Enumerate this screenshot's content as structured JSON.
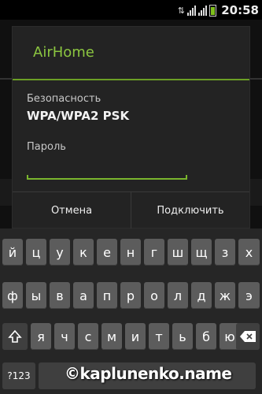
{
  "status_bar": {
    "time": "20:58"
  },
  "dialog": {
    "title": "AirHome",
    "security_label": "Безопасность",
    "security_value": "WPA/WPA2 PSK",
    "password_label": "Пароль",
    "password_value": "",
    "buttons": {
      "cancel": "Отмена",
      "connect": "Подключить"
    },
    "accent_color": "#8bc540"
  },
  "keyboard": {
    "rows": [
      [
        "й",
        "ц",
        "у",
        "к",
        "е",
        "н",
        "г",
        "ш",
        "щ",
        "з",
        "х"
      ],
      [
        "ф",
        "ы",
        "в",
        "а",
        "п",
        "р",
        "о",
        "л",
        "д",
        "ж",
        "э"
      ],
      [
        "я",
        "ч",
        "с",
        "м",
        "и",
        "т",
        "ь",
        "б",
        "ю"
      ]
    ],
    "shift_icon": "shift-arrow-icon",
    "backspace_icon": "backspace-icon",
    "mode_label": "?123"
  },
  "watermark": "©kaplunenko.name"
}
